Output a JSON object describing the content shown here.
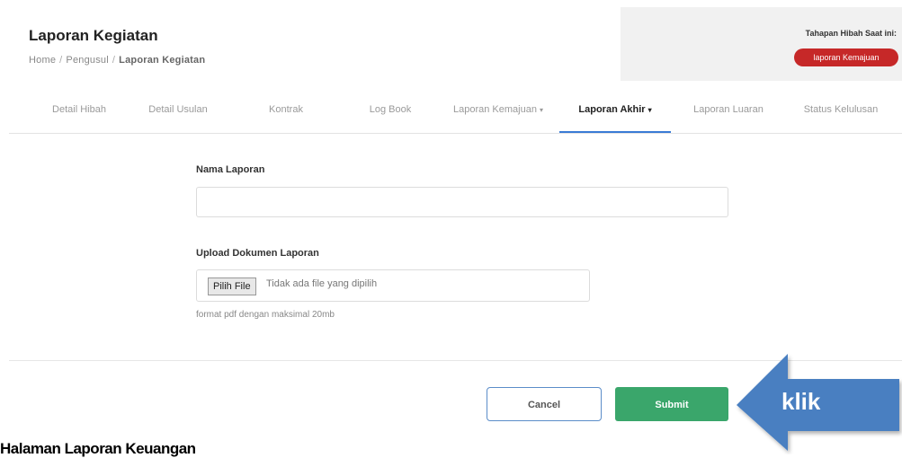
{
  "header": {
    "title": "Laporan Kegiatan",
    "breadcrumb": [
      "Home",
      "Pengusul",
      "Laporan Kegiatan"
    ]
  },
  "stage": {
    "label": "Tahapan Hibah Saat ini:",
    "badge": "laporan Kemajuan",
    "badge_color": "#c62828"
  },
  "tabs": [
    {
      "label": "Detail Hibah"
    },
    {
      "label": "Detail Usulan"
    },
    {
      "label": "Kontrak"
    },
    {
      "label": "Log Book"
    },
    {
      "label": "Laporan Kemajuan",
      "caret": "▾"
    },
    {
      "label": "Laporan Akhir",
      "caret": "▾",
      "active": true
    },
    {
      "label": "Laporan Luaran"
    },
    {
      "label": "Status Kelulusan"
    }
  ],
  "form": {
    "name_label": "Nama Laporan",
    "name_value": "",
    "upload_label": "Upload Dokumen Laporan",
    "file_button": "Pilih File",
    "file_status": "Tidak ada file yang dipilih",
    "hint": "format pdf dengan maksimal 20mb"
  },
  "actions": {
    "cancel_label": "Cancel",
    "submit_label": "Submit",
    "submit_color": "#3aa66b"
  },
  "annotation": {
    "arrow_text": "klik",
    "arrow_color": "#4a7fc1"
  },
  "footer_heading": "Halaman Laporan Keuangan"
}
